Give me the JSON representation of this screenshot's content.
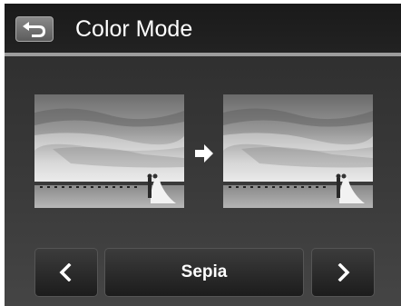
{
  "header": {
    "title": "Color Mode",
    "back_icon": "return-arrow-icon"
  },
  "preview": {
    "before_image": "beach-wedding-photo-original",
    "after_image": "beach-wedding-photo-preview",
    "transition_icon": "arrow-right-icon"
  },
  "selector": {
    "prev_icon": "chevron-left-icon",
    "current_mode": "Sepia",
    "next_icon": "chevron-right-icon"
  },
  "colors": {
    "header_bg": "#1e1e1e",
    "divider": "#9c9c9c",
    "button_bg": "#2a2a2a",
    "text": "#ffffff"
  }
}
